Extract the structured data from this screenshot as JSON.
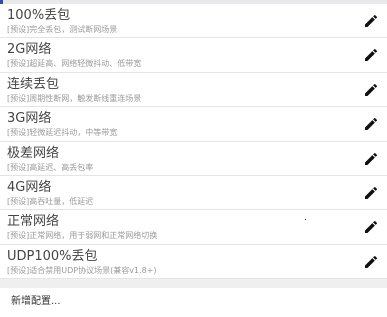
{
  "profiles": [
    {
      "name": "100%丢包",
      "desc": "[预设]完全丢包，测试断网场景",
      "edit_icon": "pencil-icon"
    },
    {
      "name": "2G网络",
      "desc": "[预设]超延高、网络轻微抖动、低带宽",
      "edit_icon": "pencil-icon"
    },
    {
      "name": "连续丢包",
      "desc": "[预设]周期性断网，触发断线重连场景",
      "edit_icon": "pencil-icon"
    },
    {
      "name": "3G网络",
      "desc": "[预设]轻微延迟抖动，中等带宽",
      "edit_icon": "pencil-icon"
    },
    {
      "name": "极差网络",
      "desc": "[预设]高延迟、高丢包率",
      "edit_icon": "pencil-icon"
    },
    {
      "name": "4G网络",
      "desc": "[预设]高吞吐量，低延迟",
      "edit_icon": "pencil-icon"
    },
    {
      "name": "正常网络",
      "desc": "[预设]正常网络，用于弱网和正常网络切换",
      "edit_icon": "pencil-icon"
    },
    {
      "name": "UDP100%丢包",
      "desc": "[预设]适合禁用UDP协议场景(兼容v1.8+)",
      "edit_icon": "pencil-icon"
    }
  ],
  "add_config_label": "新增配置...",
  "colors": {
    "accent": "#3b4a9a",
    "icon": "#111111"
  }
}
